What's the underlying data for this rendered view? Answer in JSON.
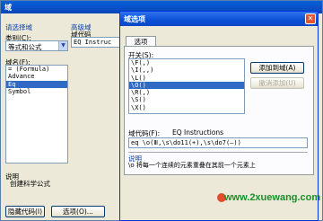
{
  "main_window": {
    "title": "域",
    "select_field_label": "请选择域",
    "category_label": "类别(C):",
    "category_value": "等式和公式",
    "fieldname_label": "域名(F):",
    "fieldnames": [
      "= (Formula)",
      "Advance",
      "Eq",
      "Symbol"
    ],
    "selected_fieldname_index": 2,
    "advanced_label": "高级域",
    "field_code_label": "域代码",
    "field_code_value": "EQ Instruc",
    "description_label": "说明",
    "description_text": "创建科学公式",
    "hide_codes_button": "隐藏代码(I)",
    "options_button": "选项(O)..."
  },
  "options_dialog": {
    "title": "域选项",
    "tab_label": "选项",
    "switches_label": "开关(S):",
    "switches": [
      "\\F(,)",
      "\\I(,,)",
      "\\L()",
      "\\O()",
      "\\R(,)",
      "\\S()",
      "\\X()"
    ],
    "selected_switch_index": 3,
    "add_button": "添加到域(A)",
    "undo_button": "撤消添加(U)",
    "field_code_label": "域代码(F):",
    "field_code_hint": "EQ Instructions",
    "field_code_value": "eq \\o(Ⅲ,\\s\\do11(+),\\s\\do7(—))",
    "description_label": "说明",
    "description_text": "\\o 将每一个连续的元素重叠在其前一个元素上"
  },
  "watermark": "www.2xuewang.com",
  "colors": {
    "selection": "#316ac5",
    "titlebar": "#0a48c7",
    "watermark": "#1a8f2a"
  }
}
